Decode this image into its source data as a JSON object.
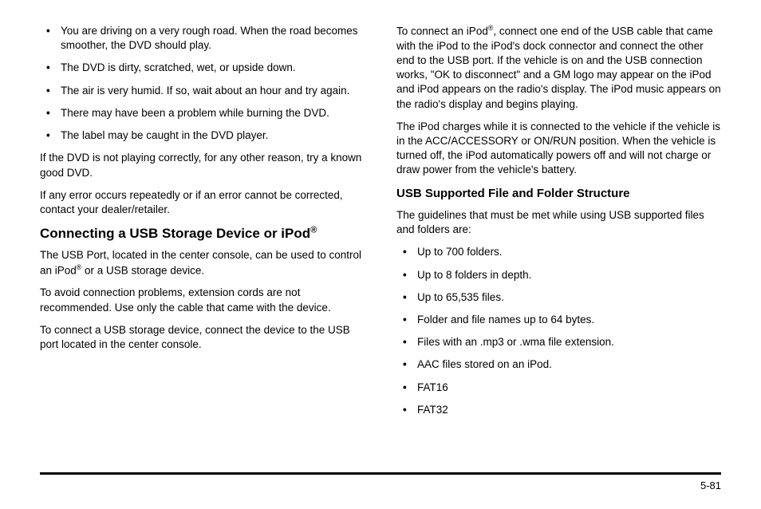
{
  "left": {
    "bullets_dvd": [
      "You are driving on a very rough road. When the road becomes smoother, the DVD should play.",
      "The DVD is dirty, scratched, wet, or upside down.",
      "The air is very humid. If so, wait about an hour and try again.",
      "There may have been a problem while burning the DVD.",
      "The label may be caught in the DVD player."
    ],
    "p1": "If the DVD is not playing correctly, for any other reason, try a known good DVD.",
    "p2": "If any error occurs repeatedly or if an error cannot be corrected, contact your dealer/retailer.",
    "h2_pre": "Connecting a USB Storage Device or iPod",
    "h2_sup": "®",
    "p3_pre": "The USB Port, located in the center console, can be used to control an iPod",
    "p3_sup": "®",
    "p3_post": " or a USB storage device.",
    "p4": "To avoid connection problems, extension cords are not recommended. Use only the cable that came with the device.",
    "p5": "To connect a USB storage device, connect the device to the USB port located in the center console."
  },
  "right": {
    "p1_pre": "To connect an iPod",
    "p1_sup": "®",
    "p1_post": ", connect one end of the USB cable that came with the iPod to the iPod's dock connector and connect the other end to the USB port. If the vehicle is on and the USB connection works, \"OK to disconnect\" and a GM logo may appear on the iPod and iPod appears on the radio's display. The iPod music appears on the radio's display and begins playing.",
    "p2": "The iPod charges while it is connected to the vehicle if the vehicle is in the ACC/ACCESSORY or ON/RUN position. When the vehicle is turned off, the iPod automatically powers off and will not charge or draw power from the vehicle's battery.",
    "h3": "USB Supported File and Folder Structure",
    "p3": "The guidelines that must be met while using USB supported files and folders are:",
    "bullets_usb": [
      "Up to 700 folders.",
      "Up to 8 folders in depth.",
      "Up to 65,535 files.",
      "Folder and file names up to 64 bytes.",
      "Files with an .mp3 or .wma file extension.",
      "AAC files stored on an iPod.",
      "FAT16",
      "FAT32"
    ]
  },
  "page_number": "5-81"
}
